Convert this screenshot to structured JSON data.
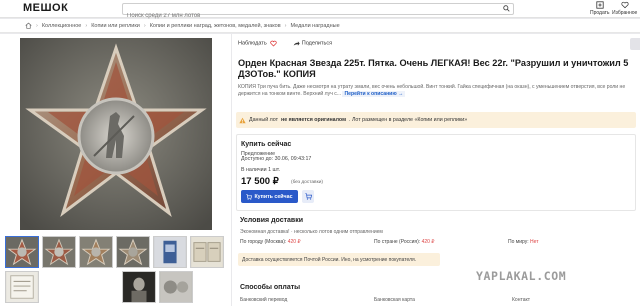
{
  "header": {
    "logo": "МЕШОК",
    "search_placeholder": "Поиск среди 27 млн лотов",
    "actions": [
      "Продать",
      "Избранное"
    ]
  },
  "breadcrumbs": [
    "Коллекционное",
    "Копии или реплики",
    "Копии и реплики наград, жетонов, медалей, знаков",
    "Медали наградные"
  ],
  "lot": {
    "favorite_label": "Наблюдать",
    "share_label": "Поделиться",
    "title": "Орден Красная Звезда 225т. Пятка. Очень ЛЕГКАЯ! Вес 22г. \"Разрушил и уничтожил 5 ДЗОТов.\" КОПИЯ",
    "description": "КОПИЯ Три пуча бить. Даже несмотря на утрату эмали, вес очень небольшой. Винт тонкий. Гайка специфичная (на оказн), с уменьшением отверстия, все роли не держится на тонком винте. Верхний луч с...",
    "more_link": "Перейти к описанию →",
    "notice_prefix": "Данный лот ",
    "notice_bold": "не является оригиналом",
    "notice_suffix": ". Лот размещен в разделе «Копии или реплики»"
  },
  "buy": {
    "title": "Купить сейчас",
    "tag": "Предложение",
    "available_until": "Доступно до: 30.06, 09:43:17",
    "stock": "В наличии 1 шт.",
    "price": "17 500 ₽",
    "price_note": "(без доставки)",
    "buy_button": "Купить сейчас"
  },
  "shipping": {
    "title": "Условия доставки",
    "subtitle": "Экономная доставка! · несколько лотов одним отправлением",
    "city_label": "По городу (Москва):",
    "city_price": "420 ₽",
    "country_label": "По стране (Россия):",
    "country_price": "420 ₽",
    "world_label": "По миру:",
    "world_value": "Нет",
    "note": "Доставка осуществляется Почтой России. Ино, на усмотрение покупателя."
  },
  "payment": {
    "title": "Способы оплаты",
    "methods": [
      "Банковский перевод",
      "Банковская карта",
      "Контакт"
    ]
  },
  "watermark": "YAPLAKAL.COM",
  "colors": {
    "accent": "#2a59c9",
    "notice_bg": "#fbf0dc"
  }
}
